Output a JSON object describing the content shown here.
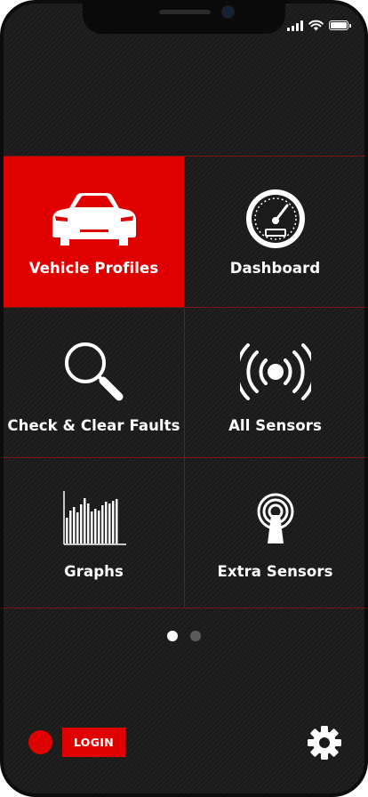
{
  "status_bar": {
    "signal_icon": "signal-bars-icon",
    "wifi_icon": "wifi-icon",
    "battery_icon": "battery-icon"
  },
  "menu": [
    {
      "label": "Vehicle Profiles",
      "icon": "car-icon",
      "selected": true
    },
    {
      "label": "Dashboard",
      "icon": "speedometer-icon",
      "selected": false
    },
    {
      "label": "Check & Clear Faults",
      "icon": "magnifier-icon",
      "selected": false
    },
    {
      "label": "All Sensors",
      "icon": "sensor-waves-icon",
      "selected": false
    },
    {
      "label": "Graphs",
      "icon": "bar-graph-icon",
      "selected": false
    },
    {
      "label": "Extra Sensors",
      "icon": "antenna-icon",
      "selected": false
    }
  ],
  "pager": {
    "pages": 2,
    "current": 1
  },
  "footer": {
    "connection_indicator": "red-status-dot",
    "login_label": "LOGIN",
    "settings_icon": "gear-icon"
  },
  "colors": {
    "accent": "#e00000",
    "background": "#1b1b1b",
    "grid_lines": "#7a1515",
    "text": "#ffffff"
  }
}
